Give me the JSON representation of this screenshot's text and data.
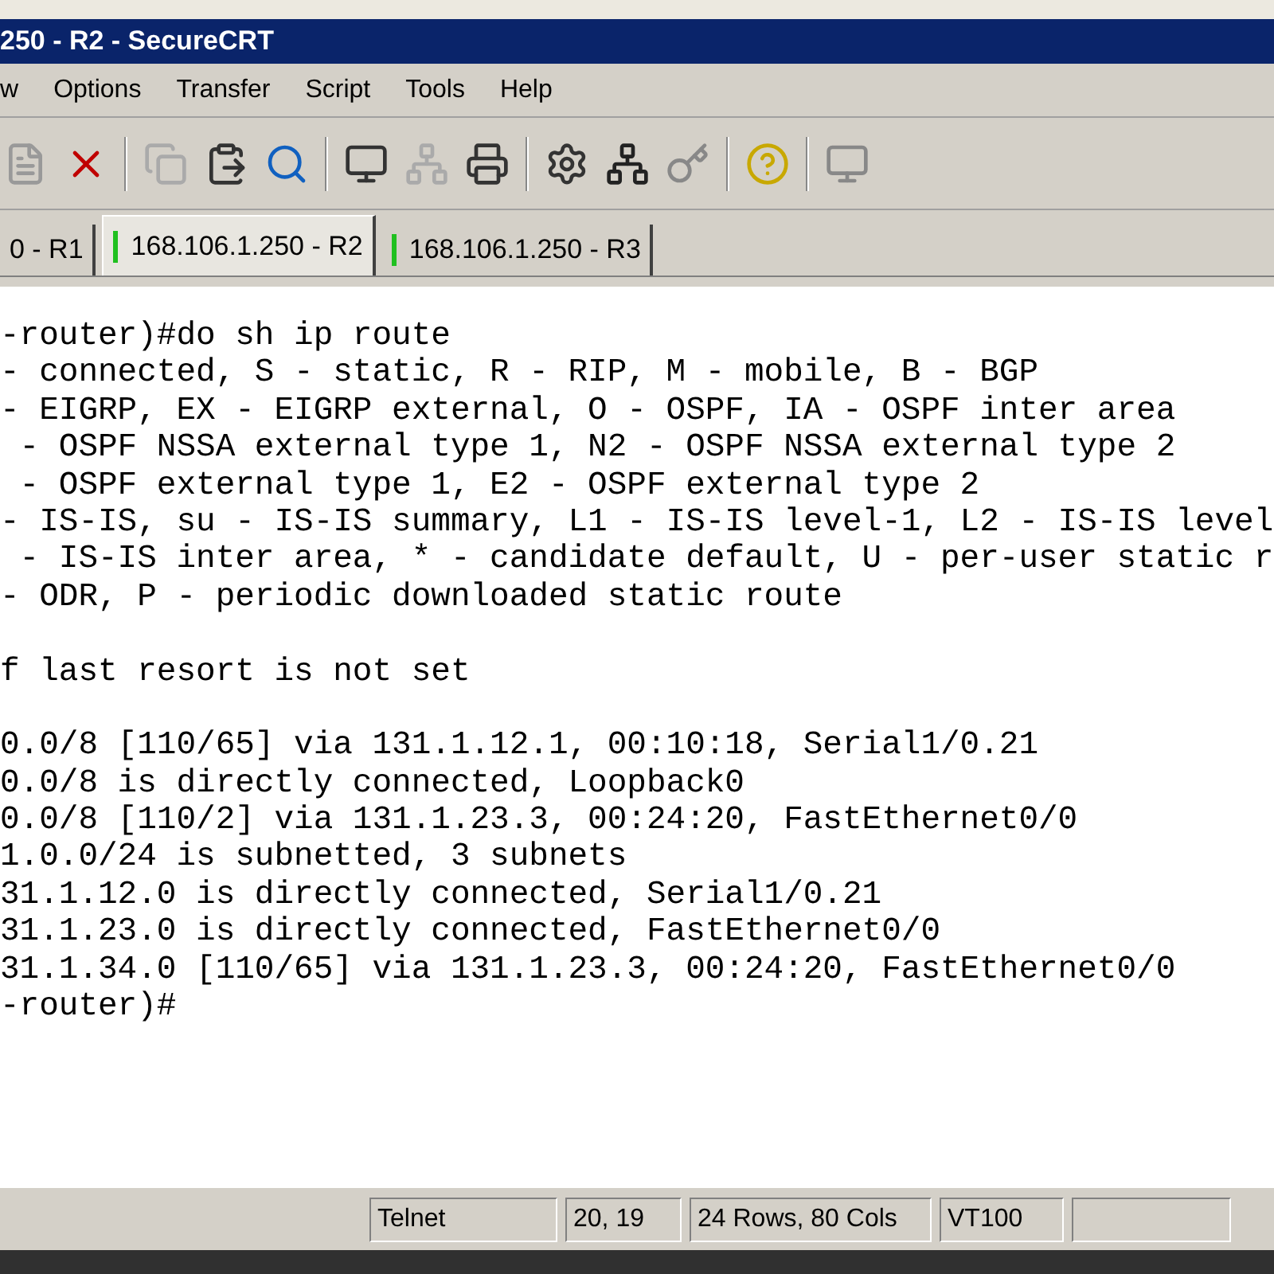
{
  "window": {
    "title": "250 - R2 - SecureCRT"
  },
  "menu": [
    "w",
    "Options",
    "Transfer",
    "Script",
    "Tools",
    "Help"
  ],
  "tabs": [
    {
      "label": "0 - R1",
      "selected": false,
      "connected": false
    },
    {
      "label": "168.106.1.250 - R2",
      "selected": true,
      "connected": true
    },
    {
      "label": "168.106.1.250 - R3",
      "selected": false,
      "connected": true
    }
  ],
  "terminal": {
    "blocks": [
      [
        "-router)#do sh ip route",
        "- connected, S - static, R - RIP, M - mobile, B - BGP",
        "- EIGRP, EX - EIGRP external, O - OSPF, IA - OSPF inter area",
        " - OSPF NSSA external type 1, N2 - OSPF NSSA external type 2",
        " - OSPF external type 1, E2 - OSPF external type 2",
        "- IS-IS, su - IS-IS summary, L1 - IS-IS level-1, L2 - IS-IS level",
        " - IS-IS inter area, * - candidate default, U - per-user static r",
        "- ODR, P - periodic downloaded static route"
      ],
      [
        "f last resort is not set"
      ],
      [
        "0.0/8 [110/65] via 131.1.12.1, 00:10:18, Serial1/0.21",
        "0.0/8 is directly connected, Loopback0",
        "0.0/8 [110/2] via 131.1.23.3, 00:24:20, FastEthernet0/0",
        "1.0.0/24 is subnetted, 3 subnets",
        "31.1.12.0 is directly connected, Serial1/0.21",
        "31.1.23.0 is directly connected, FastEthernet0/0",
        "31.1.34.0 [110/65] via 131.1.23.3, 00:24:20, FastEthernet0/0",
        "-router)#"
      ]
    ]
  },
  "status_bar": [
    "Telnet",
    "20, 19",
    "24 Rows,  80 Cols",
    "VT100"
  ]
}
